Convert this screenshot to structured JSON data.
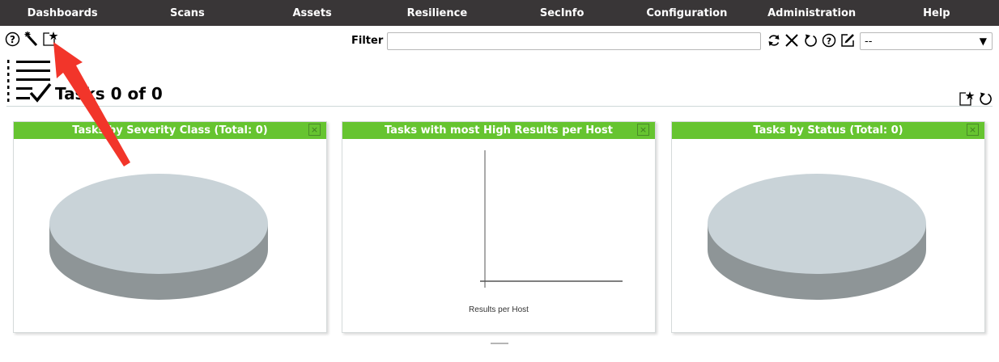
{
  "nav": {
    "items": [
      {
        "label": "Dashboards"
      },
      {
        "label": "Scans"
      },
      {
        "label": "Assets"
      },
      {
        "label": "Resilience"
      },
      {
        "label": "SecInfo"
      },
      {
        "label": "Configuration"
      },
      {
        "label": "Administration"
      },
      {
        "label": "Help"
      }
    ]
  },
  "toolbar": {
    "icons": [
      "help-icon",
      "wizard-icon",
      "new-task-icon"
    ]
  },
  "filter": {
    "label": "Filter",
    "value": "",
    "selected": "--",
    "icons": [
      "refresh-icon",
      "clear-icon",
      "reset-icon",
      "help-icon",
      "edit-icon"
    ]
  },
  "section": {
    "title": "Tasks 0 of 0",
    "icons": [
      "tasks-list-icon",
      "new-dashboard-display-icon",
      "reset-dashboard-icon"
    ]
  },
  "panels": [
    {
      "title": "Tasks by Severity Class (Total: 0)",
      "type": "pie",
      "close": "×"
    },
    {
      "title": "Tasks with most High Results per Host",
      "type": "bar",
      "close": "×",
      "xlabel": "Results per Host"
    },
    {
      "title": "Tasks by Status (Total: 0)",
      "type": "pie",
      "close": "×"
    }
  ],
  "colors": {
    "nav_bg": "#393637",
    "panel_header": "#66c430",
    "pie_top": "#c9d3d8",
    "pie_side": "#8e9597",
    "annotation_arrow": "#f2352a"
  },
  "chart_data": [
    {
      "type": "pie",
      "title": "Tasks by Severity Class (Total: 0)",
      "values": [],
      "total": 0
    },
    {
      "type": "bar",
      "title": "Tasks with most High Results per Host",
      "categories": [],
      "values": [],
      "xlabel": "Results per Host",
      "ylabel": ""
    },
    {
      "type": "pie",
      "title": "Tasks by Status (Total: 0)",
      "values": [],
      "total": 0
    }
  ]
}
